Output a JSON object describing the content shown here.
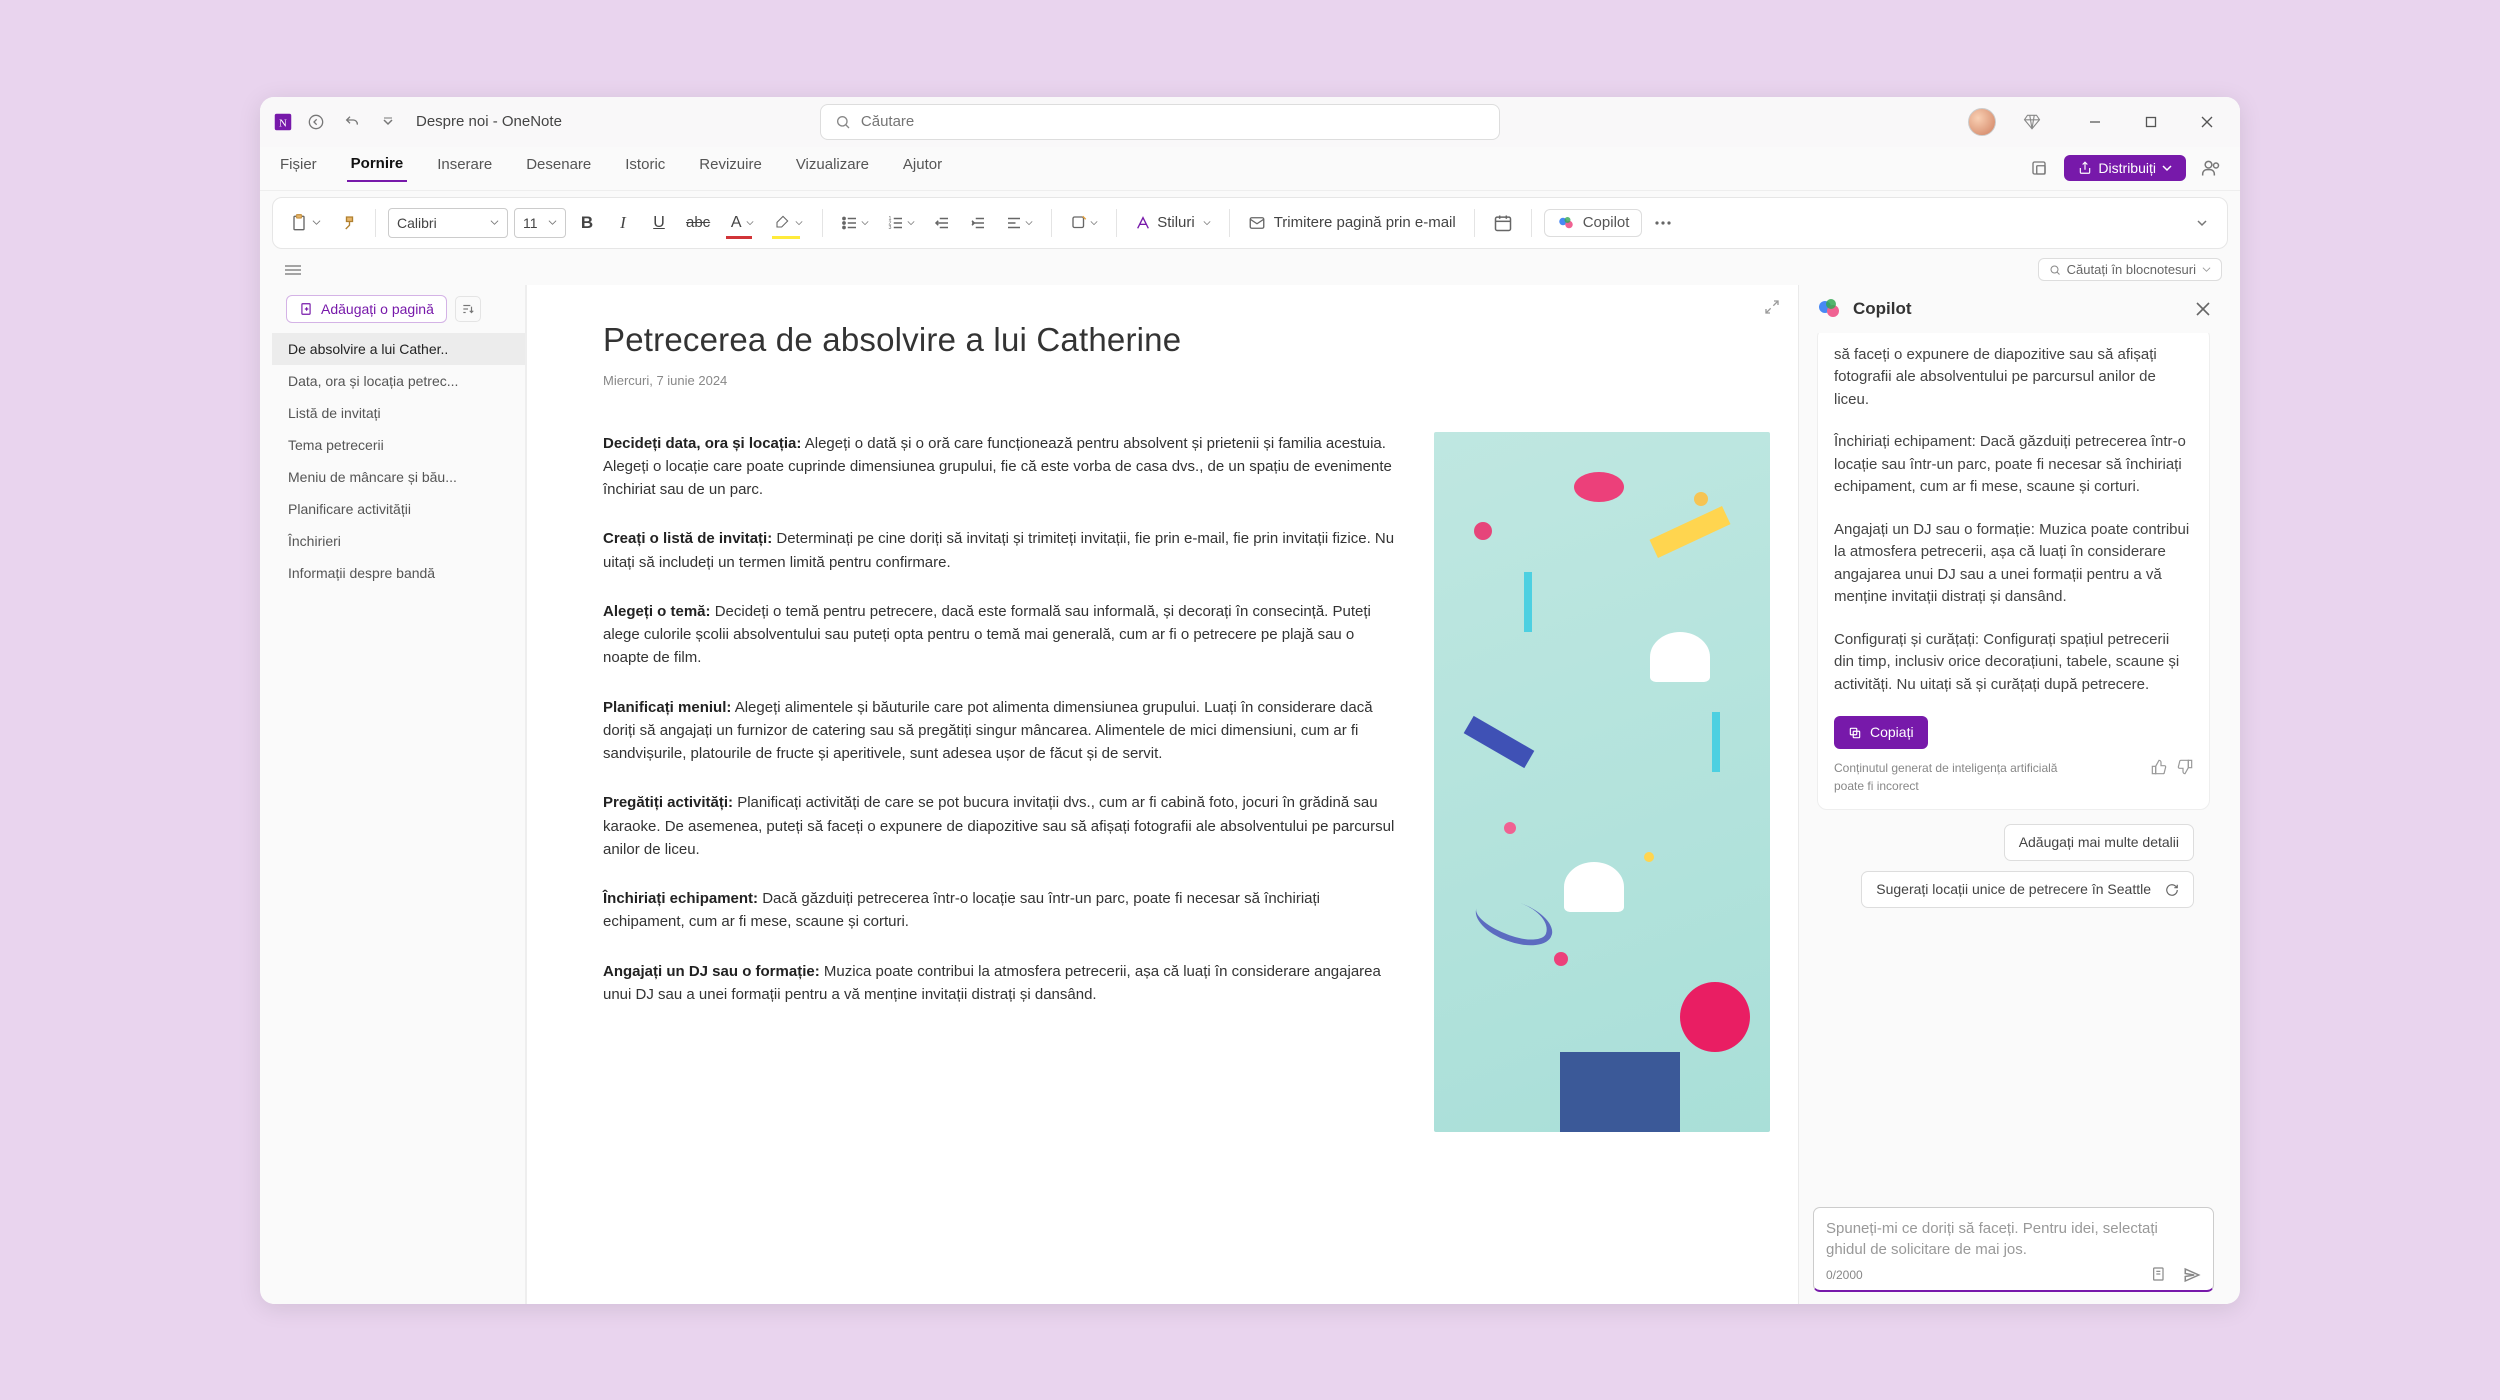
{
  "title": "Despre noi - OneNote",
  "search_placeholder": "Căutare",
  "menu": {
    "items": [
      "Fișier",
      "Pornire",
      "Inserare",
      "Desenare",
      "Istoric",
      "Revizuire",
      "Vizualizare",
      "Ajutor"
    ],
    "active": "Pornire",
    "share": "Distribuiți"
  },
  "ribbon": {
    "font": "Calibri",
    "size": "11",
    "styles": "Stiluri",
    "email": "Trimitere pagină prin e-mail",
    "copilot": "Copilot"
  },
  "notesearch": "Căutați în blocnotesuri",
  "pagelist": {
    "addpage": "Adăugați o pagină",
    "items": [
      "De absolvire a lui Cather..",
      "Data, ora și locația petrec...",
      "Listă de invitați",
      "Tema petrecerii",
      "Meniu de mâncare și bău...",
      "Planificare activității",
      "Închirieri",
      "Informații despre bandă"
    ]
  },
  "doc": {
    "title": "Petrecerea de absolvire a lui Catherine",
    "date": "Miercuri, 7 iunie 2024",
    "paras": [
      {
        "b": "Decideți data, ora și locația:",
        "t": " Alegeți o dată și o oră care funcționează pentru absolvent și prietenii și familia acestuia. Alegeți o locație care poate cuprinde dimensiunea grupului, fie că este vorba de casa dvs., de un spațiu de evenimente închiriat sau de un parc."
      },
      {
        "b": "Creați o listă de invitați:",
        "t": " Determinați pe cine doriți să invitați și trimiteți invitații, fie prin e-mail, fie prin invitații fizice. Nu uitați să includeți un termen limită pentru confirmare."
      },
      {
        "b": "Alegeți o temă:",
        "t": " Decideți o temă pentru petrecere, dacă este formală sau informală, și decorați în consecință. Puteți alege culorile școlii absolventului sau puteți opta pentru o temă mai generală, cum ar fi o petrecere pe plajă sau o noapte de film."
      },
      {
        "b": "Planificați meniul:",
        "t": " Alegeți alimentele și băuturile care pot alimenta dimensiunea grupului. Luați în considerare dacă doriți să angajați un furnizor de catering sau să pregătiți singur mâncarea. Alimentele de mici dimensiuni, cum ar fi sandvișurile, platourile de fructe și aperitivele, sunt adesea ușor de făcut și de servit."
      },
      {
        "b": "Pregătiți activități:",
        "t": " Planificați activități de care se pot bucura invitații dvs., cum ar fi cabină foto, jocuri în grădină sau karaoke. De asemenea, puteți să faceți o expunere de diapozitive sau să afișați fotografii ale absolventului pe parcursul anilor de liceu."
      },
      {
        "b": "Închiriați echipament:",
        "t": " Dacă găzduiți petrecerea într-o locație sau într-un parc, poate fi necesar să închiriați echipament, cum ar fi mese, scaune și corturi."
      },
      {
        "b": "Angajați un DJ sau o formație:",
        "t": " Muzica poate contribui la atmosfera petrecerii, așa că luați în considerare angajarea unui DJ sau a unei formații pentru a vă menține invitații distrați și dansând."
      }
    ]
  },
  "copilot": {
    "title": "Copilot",
    "paras": [
      "să faceți o expunere de diapozitive sau să afișați fotografii ale absolventului pe parcursul anilor de liceu.",
      "Închiriați echipament: Dacă găzduiți petrecerea într-o locație sau într-un parc, poate fi necesar să închiriați echipament, cum ar fi mese, scaune și corturi.",
      "Angajați un DJ sau o formație: Muzica poate contribui la atmosfera petrecerii, așa că luați în considerare angajarea unui DJ sau a unei formații pentru a vă menține invitații distrați și dansând.",
      "Configurați și curățați: Configurați spațiul petrecerii din timp, inclusiv orice decorațiuni, tabele, scaune și activități. Nu uitați să și curățați după petrecere."
    ],
    "copy": "Copiați",
    "disclaimer": "Conținutul generat de inteligența artificială poate fi incorect",
    "chip1": "Adăugați mai multe detalii",
    "chip2": "Sugerați locații unice de petrecere în Seattle",
    "placeholder": "Spuneți-mi ce doriți să faceți. Pentru idei, selectați ghidul de solicitare de mai jos.",
    "counter": "0/2000"
  }
}
